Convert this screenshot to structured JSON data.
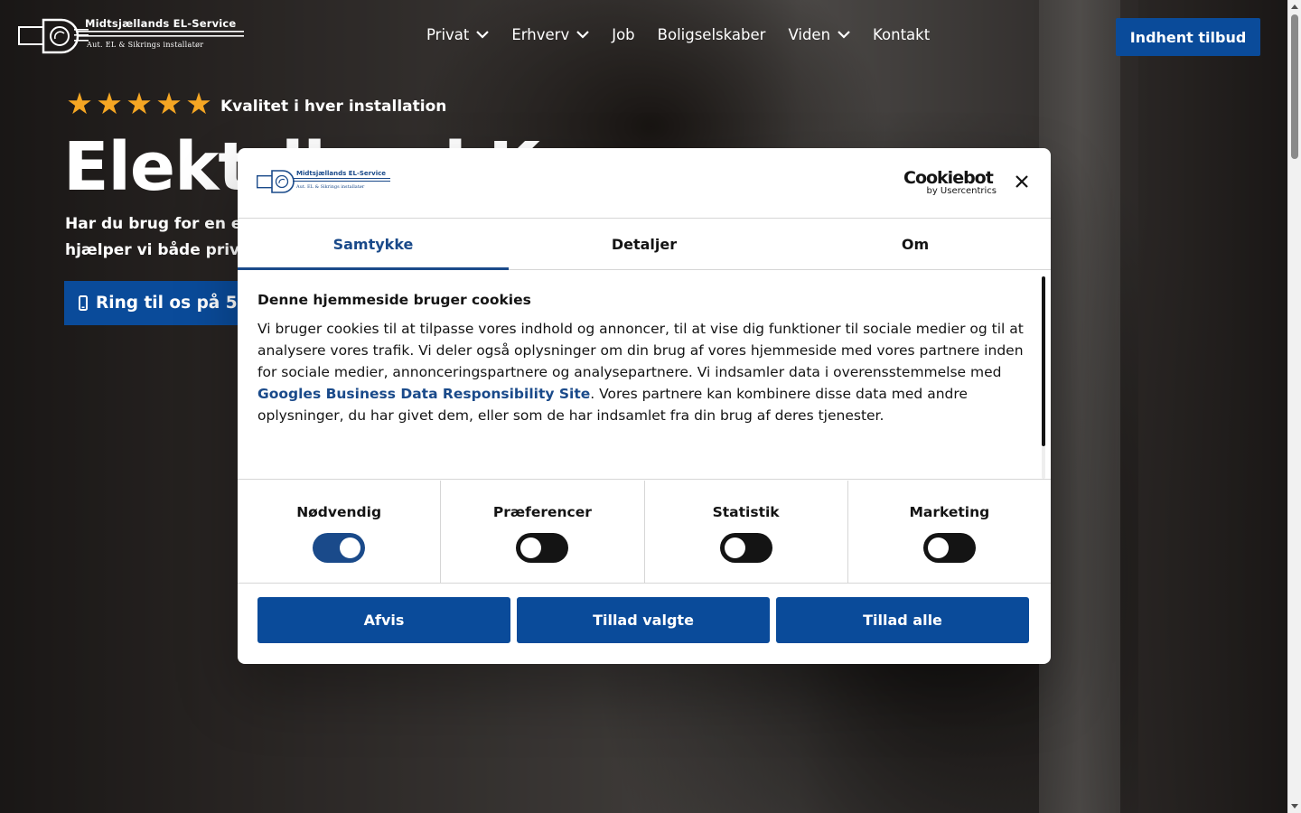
{
  "site": {
    "logo_name": "Midtsjællands EL-Service",
    "logo_tagline": "Aut. EL & Sikrings installatør",
    "nav": [
      {
        "label": "Privat",
        "has_dropdown": true
      },
      {
        "label": "Erhverv",
        "has_dropdown": true
      },
      {
        "label": "Job",
        "has_dropdown": false
      },
      {
        "label": "Boligselskaber",
        "has_dropdown": false
      },
      {
        "label": "Viden",
        "has_dropdown": true
      },
      {
        "label": "Kontakt",
        "has_dropdown": false
      }
    ],
    "cta_label": "Indhent tilbud"
  },
  "hero": {
    "rating_stars": 5,
    "rating_text": "Kvalitet i hver installation",
    "title": "Elektriker i Køge",
    "lead_line1": "Har du brug for en erfaren elektriker i Køge? Hos Midtsjællands EL-Service",
    "lead_line2": "hjælper vi både private og erhverv med alt inden for el.",
    "call_label": "Ring til os på 53"
  },
  "cookie_dialog": {
    "logo_name": "Midtsjællands EL-Service",
    "logo_tagline": "Aut. EL & Sikrings installatør",
    "provider_word": "Cookiebot",
    "provider_by": "by Usercentrics",
    "tabs": [
      {
        "label": "Samtykke",
        "active": true
      },
      {
        "label": "Detaljer",
        "active": false
      },
      {
        "label": "Om",
        "active": false
      }
    ],
    "heading": "Denne hjemmeside bruger cookies",
    "body_before_link": "Vi bruger cookies til at tilpasse vores indhold og annoncer, til at vise dig funktioner til sociale medier og til at analysere vores trafik. Vi deler også oplysninger om din brug af vores hjemmeside med vores partnere inden for sociale medier, annonceringspartnere og analysepartnere. Vi indsamler data i overensstemmelse med ",
    "body_link": "Googles Business Data Responsibility Site",
    "body_after_link": ". Vores partnere kan kombinere disse data med andre oplysninger, du har givet dem, eller som de har indsamlet fra din brug af deres tjenester.",
    "toggles": [
      {
        "label": "Nødvendig",
        "on": true
      },
      {
        "label": "Præferencer",
        "on": false
      },
      {
        "label": "Statistik",
        "on": false
      },
      {
        "label": "Marketing",
        "on": false
      }
    ],
    "buttons": {
      "reject": "Afvis",
      "allow_selected": "Tillad valgte",
      "allow_all": "Tillad alle"
    }
  },
  "colors": {
    "brand_blue": "#0a4b9a",
    "dialog_accent": "#1a4a8a",
    "star": "#f5a623"
  }
}
